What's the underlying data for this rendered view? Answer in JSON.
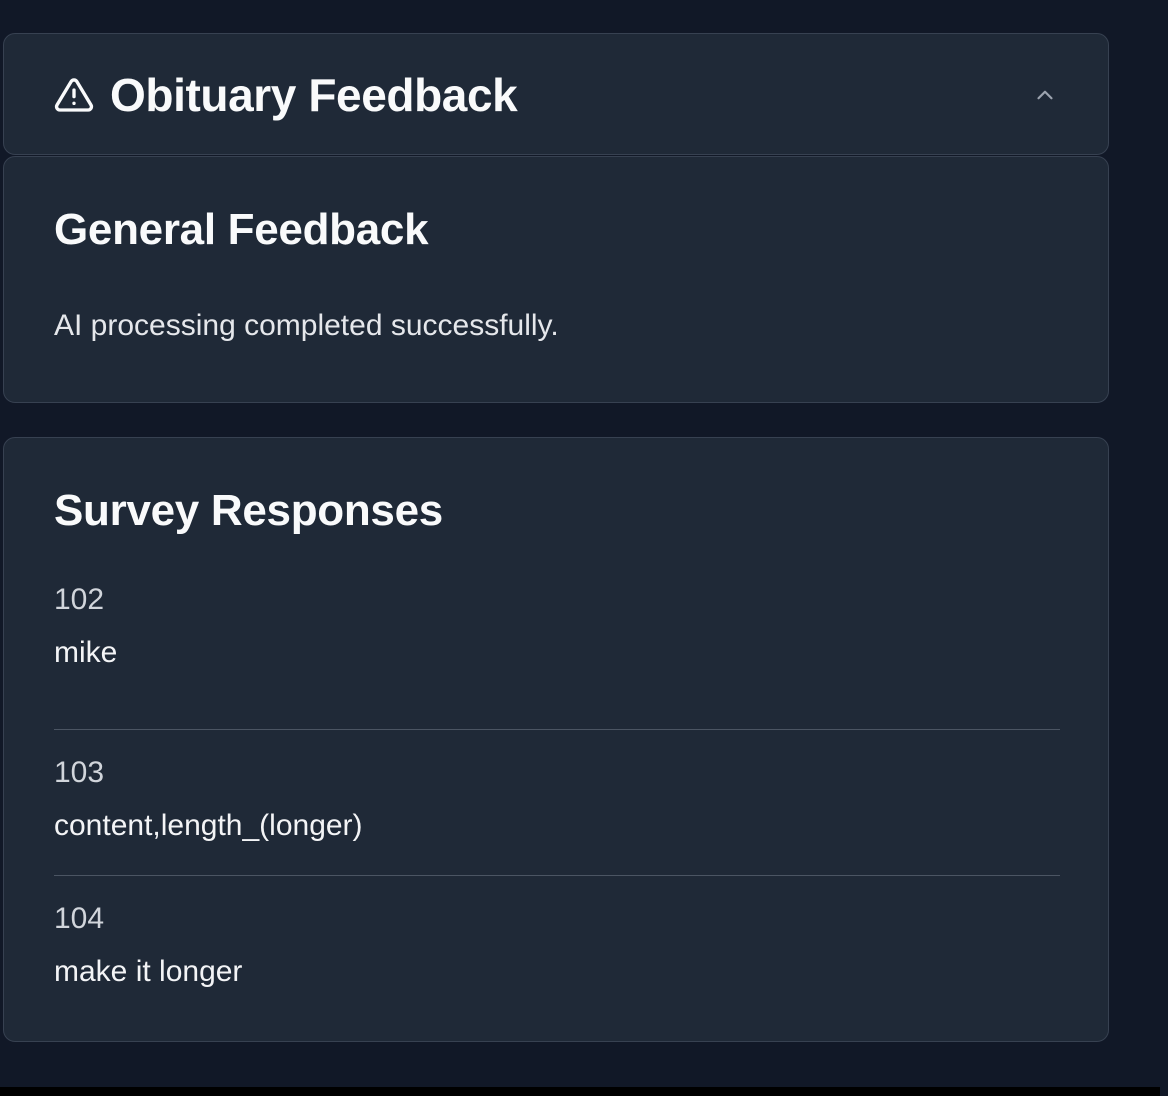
{
  "header": {
    "title": "Obituary Feedback",
    "icon": "warning-triangle-icon",
    "toggle_icon": "chevron-up-icon"
  },
  "general": {
    "title": "General Feedback",
    "text": "AI processing completed successfully."
  },
  "survey": {
    "title": "Survey Responses",
    "responses": [
      {
        "id": "102",
        "text": "mike"
      },
      {
        "id": "103",
        "text": "content,length_(longer)"
      },
      {
        "id": "104",
        "text": "make it longer"
      }
    ]
  },
  "colors": {
    "page_background": "#111827",
    "card_background": "#1f2937",
    "card_border": "#374151",
    "divider": "#4b5563"
  }
}
